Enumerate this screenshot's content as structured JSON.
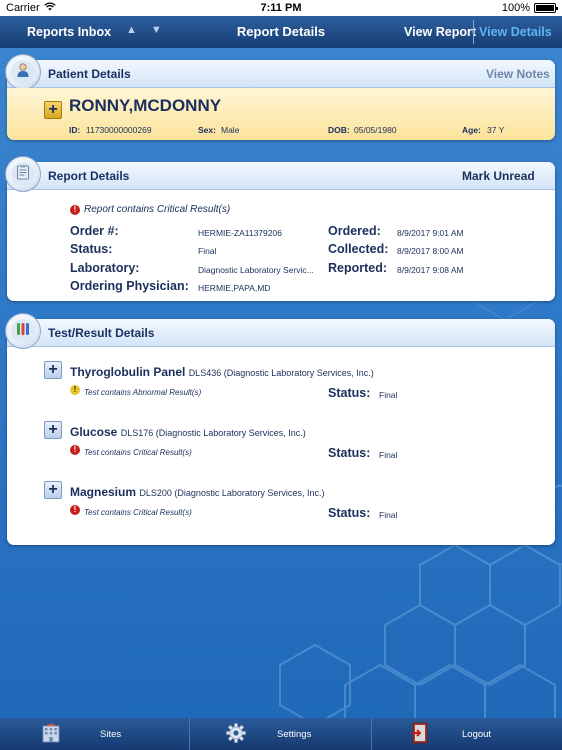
{
  "status_bar": {
    "carrier": "Carrier",
    "time": "7:11 PM",
    "battery": "100%"
  },
  "nav": {
    "back_label": "Reports Inbox",
    "title": "Report Details",
    "view_report": "View Report",
    "view_details": "View Details"
  },
  "patient": {
    "section_title": "Patient Details",
    "view_notes": "View Notes",
    "name": "RONNY,MCDONNY",
    "id_label": "ID:",
    "id_value": "11730000000269",
    "sex_label": "Sex:",
    "sex_value": "Male",
    "dob_label": "DOB:",
    "dob_value": "05/05/1980",
    "age_label": "Age:",
    "age_value": "37 Y"
  },
  "report": {
    "section_title": "Report Details",
    "mark_unread": "Mark Unread",
    "critical_note": "Report contains Critical Result(s)",
    "order_label": "Order #:",
    "order_value": "HERMIE-ZA11379206",
    "status_label": "Status:",
    "status_value": "Final",
    "lab_label": "Laboratory:",
    "lab_value": "Diagnostic Laboratory Servic...",
    "physician_label": "Ordering Physician:",
    "physician_value": "HERMIE,PAPA,MD",
    "ordered_label": "Ordered:",
    "ordered_value": "8/9/2017 9:01 AM",
    "collected_label": "Collected:",
    "collected_value": "8/9/2017 8:00 AM",
    "reported_label": "Reported:",
    "reported_value": "8/9/2017 9:08 AM"
  },
  "tests": {
    "section_title": "Test/Result Details",
    "items": [
      {
        "name": "Thyroglobulin Panel",
        "code": "DLS436 (Diagnostic Laboratory Services, Inc.)",
        "note": "Test contains Abnormal Result(s)",
        "status_label": "Status:",
        "status_value": "Final"
      },
      {
        "name": "Glucose",
        "code": "DLS176 (Diagnostic Laboratory Services, Inc.)",
        "note": "Test contains Critical Result(s)",
        "status_label": "Status:",
        "status_value": "Final"
      },
      {
        "name": "Magnesium",
        "code": "DLS200 (Diagnostic Laboratory Services, Inc.)",
        "note": "Test contains Critical Result(s)",
        "status_label": "Status:",
        "status_value": "Final"
      }
    ]
  },
  "tabbar": {
    "sites": "Sites",
    "settings": "Settings",
    "logout": "Logout"
  },
  "icons": {
    "patient": "person-icon",
    "report": "clipboard-icon",
    "tests": "test-tubes-icon",
    "critical": "exclamation-circle-icon",
    "abnormal": "warning-circle-icon",
    "sites": "building-icon",
    "settings": "gear-icon",
    "logout": "logout-door-icon"
  },
  "colors": {
    "accent_link": "#5fb5f2",
    "critical": "#c81d1d",
    "abnormal": "#e5c528",
    "patient_highlight": "#fbe39a"
  }
}
